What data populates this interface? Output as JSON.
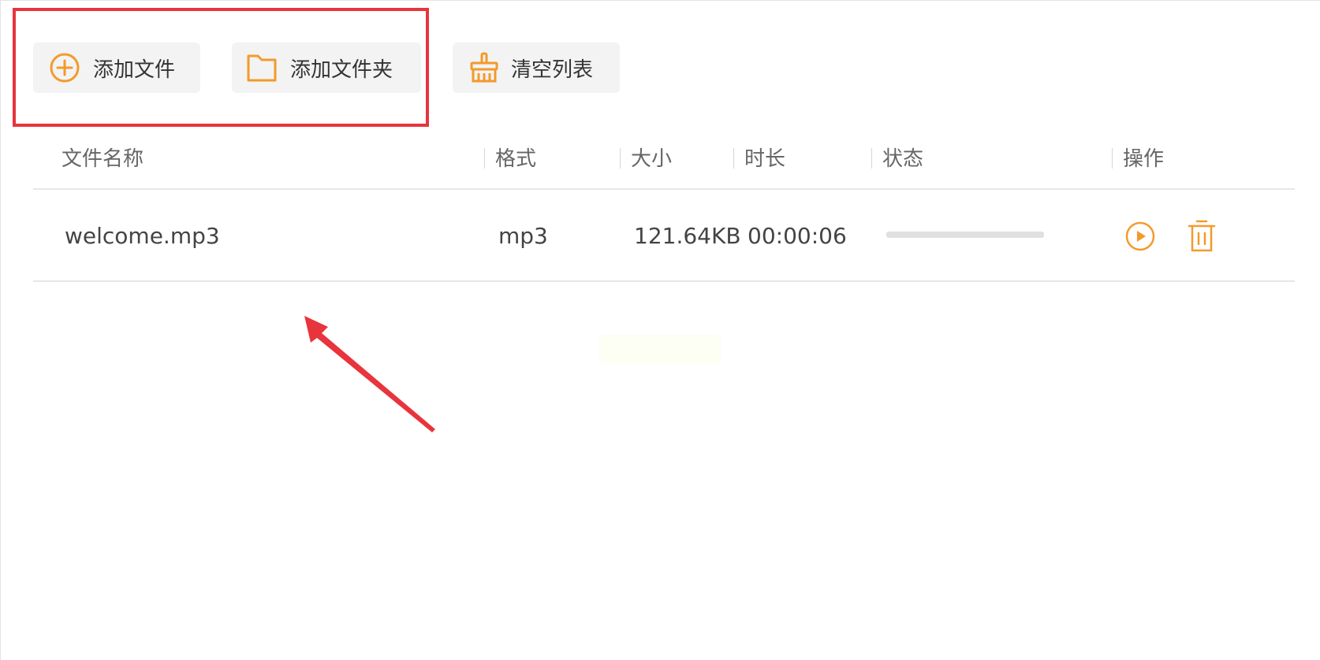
{
  "toolbar": {
    "add_file_label": "添加文件",
    "add_folder_label": "添加文件夹",
    "clear_list_label": "清空列表"
  },
  "icons": {
    "add_file": "plus-circle-icon",
    "add_folder": "folder-icon",
    "clear_list": "broom-icon",
    "play": "play-circle-icon",
    "delete": "trash-icon"
  },
  "colors": {
    "accent": "#f39a2b",
    "annotation_red": "#e8343c"
  },
  "table": {
    "columns": [
      "文件名称",
      "格式",
      "大小",
      "时长",
      "状态",
      "操作"
    ],
    "rows": [
      {
        "name": "welcome.mp3",
        "format": "mp3",
        "size": "121.64KB",
        "duration": "00:00:06",
        "progress": 0
      }
    ]
  }
}
